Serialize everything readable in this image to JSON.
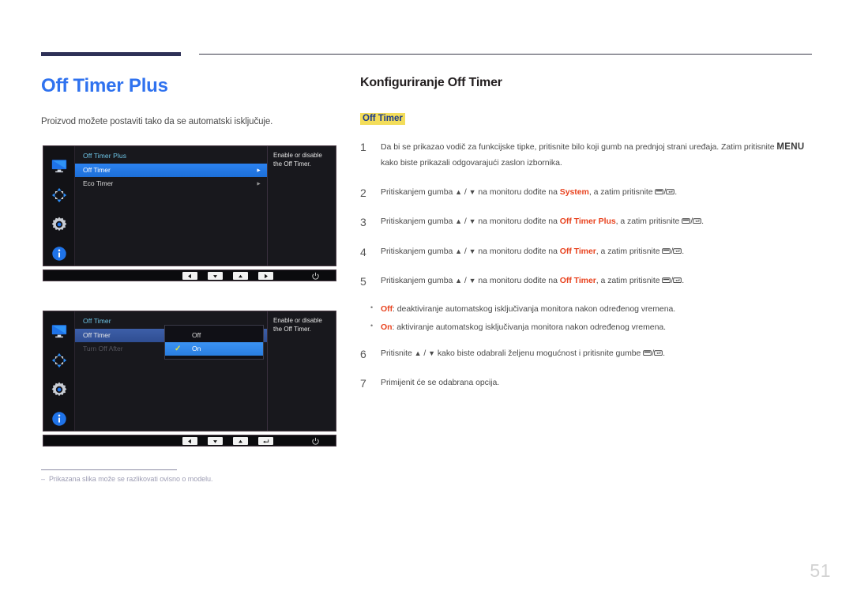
{
  "document": {
    "page_number": "51"
  },
  "left": {
    "title": "Off Timer Plus",
    "intro": "Proizvod možete postaviti tako da se automatski isključuje.",
    "footnote_dash": "‒",
    "footnote": "Prikazana slika može se razlikovati ovisno o modelu."
  },
  "osd1": {
    "menu_title": "Off Timer Plus",
    "rows": [
      {
        "label": "Off Timer",
        "state": "selected",
        "caret": "►"
      },
      {
        "label": "Eco Timer",
        "state": "normal",
        "caret": "►"
      }
    ],
    "help": "Enable or disable the Off Timer.",
    "keys": [
      "left-arrow-key",
      "down-arrow-key",
      "up-arrow-key",
      "right-arrow-key"
    ],
    "power_icon": "power-icon"
  },
  "osd2": {
    "menu_title": "Off Timer",
    "rows": [
      {
        "label": "Off Timer",
        "state": "selected-dim"
      },
      {
        "label": "Turn Off After",
        "state": "disabled"
      }
    ],
    "popup": {
      "options": [
        {
          "label": "Off",
          "checked": false
        },
        {
          "label": "On",
          "checked": true
        }
      ],
      "check_glyph": "✓"
    },
    "help": "Enable or disable the Off Timer.",
    "keys": [
      "left-arrow-key",
      "down-arrow-key",
      "up-arrow-key",
      "enter-key"
    ],
    "power_icon": "power-icon"
  },
  "right": {
    "section_title": "Konfiguriranje Off Timer",
    "highlight_label": "Off Timer",
    "steps": [
      {
        "num": "1",
        "parts": [
          {
            "t": "Da bi se prikazao vodič za funkcijske tipke, pritisnite bilo koji gumb na prednjoj strani uređaja. Zatim pritisnite "
          },
          {
            "t": "MENU",
            "style": "menu"
          },
          {
            "t": " kako biste prikazali odgovarajući zaslon izbornika."
          }
        ]
      },
      {
        "num": "2",
        "parts": [
          {
            "t": "Pritiskanjem gumba "
          },
          {
            "t": "▲",
            "style": "glyph"
          },
          {
            "t": " / "
          },
          {
            "t": "▼",
            "style": "glyph"
          },
          {
            "t": " na monitoru dođite na "
          },
          {
            "t": "System",
            "style": "kw"
          },
          {
            "t": ", a zatim pritisnite "
          },
          {
            "t": "btn-back",
            "style": "icon"
          },
          {
            "t": "/"
          },
          {
            "t": "btn-enter",
            "style": "icon"
          },
          {
            "t": "."
          }
        ]
      },
      {
        "num": "3",
        "parts": [
          {
            "t": "Pritiskanjem gumba "
          },
          {
            "t": "▲",
            "style": "glyph"
          },
          {
            "t": " / "
          },
          {
            "t": "▼",
            "style": "glyph"
          },
          {
            "t": " na monitoru dođite na "
          },
          {
            "t": "Off Timer Plus",
            "style": "kw"
          },
          {
            "t": ", a zatim pritisnite "
          },
          {
            "t": "btn-back",
            "style": "icon"
          },
          {
            "t": "/"
          },
          {
            "t": "btn-enter",
            "style": "icon"
          },
          {
            "t": "."
          }
        ]
      },
      {
        "num": "4",
        "parts": [
          {
            "t": "Pritiskanjem gumba "
          },
          {
            "t": "▲",
            "style": "glyph"
          },
          {
            "t": " / "
          },
          {
            "t": "▼",
            "style": "glyph"
          },
          {
            "t": " na monitoru dođite na "
          },
          {
            "t": "Off Timer",
            "style": "kw"
          },
          {
            "t": ", a zatim pritisnite "
          },
          {
            "t": "btn-back",
            "style": "icon"
          },
          {
            "t": "/"
          },
          {
            "t": "btn-enter",
            "style": "icon"
          },
          {
            "t": "."
          }
        ]
      },
      {
        "num": "5",
        "parts": [
          {
            "t": "Pritiskanjem gumba "
          },
          {
            "t": "▲",
            "style": "glyph"
          },
          {
            "t": " / "
          },
          {
            "t": "▼",
            "style": "glyph"
          },
          {
            "t": " na monitoru dođite na "
          },
          {
            "t": "Off Timer",
            "style": "kw"
          },
          {
            "t": ", a zatim pritisnite "
          },
          {
            "t": "btn-back",
            "style": "icon"
          },
          {
            "t": "/"
          },
          {
            "t": "btn-enter",
            "style": "icon"
          },
          {
            "t": "."
          }
        ]
      }
    ],
    "bullets": [
      {
        "parts": [
          {
            "t": "Off",
            "style": "kw"
          },
          {
            "t": ": deaktiviranje automatskog isključivanja monitora nakon određenog vremena."
          }
        ]
      },
      {
        "parts": [
          {
            "t": "On",
            "style": "kw"
          },
          {
            "t": ": aktiviranje automatskog isključivanja monitora nakon određenog vremena."
          }
        ]
      }
    ],
    "steps_tail": [
      {
        "num": "6",
        "parts": [
          {
            "t": "Pritisnite "
          },
          {
            "t": "▲",
            "style": "glyph"
          },
          {
            "t": " / "
          },
          {
            "t": "▼",
            "style": "glyph"
          },
          {
            "t": " kako biste odabrali željenu mogućnost i pritisnite gumbe "
          },
          {
            "t": "btn-back",
            "style": "icon"
          },
          {
            "t": "/"
          },
          {
            "t": "btn-enter",
            "style": "icon"
          },
          {
            "t": "."
          }
        ]
      },
      {
        "num": "7",
        "parts": [
          {
            "t": "Primijenit će se odabrana opcija."
          }
        ]
      }
    ]
  },
  "colors": {
    "title_blue": "#2f72ef",
    "keyword_red": "#e8431f",
    "highlight_yellow": "#f3dd5a",
    "highlight_text": "#1b3a8c",
    "rule_navy": "#2e3157",
    "osd_selected_blue": "#2b82f0"
  }
}
